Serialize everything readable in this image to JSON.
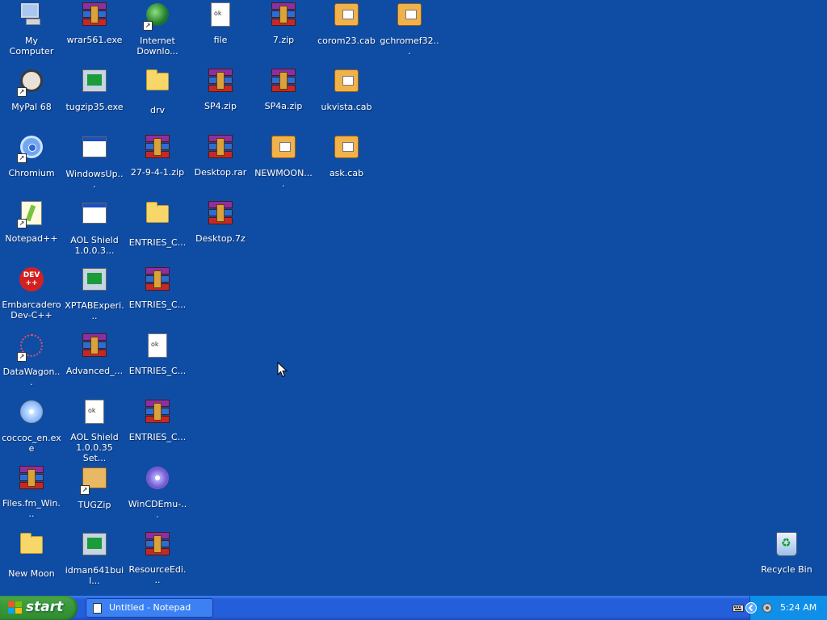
{
  "desktop": {
    "icons": [
      {
        "label": "My Computer"
      },
      {
        "label": "wrar561.exe"
      },
      {
        "label": "Internet Downlo..."
      },
      {
        "label": "file"
      },
      {
        "label": "7.zip"
      },
      {
        "label": "corom23.cab"
      },
      {
        "label": "gchromef32..."
      },
      {
        "label": "MyPal 68"
      },
      {
        "label": "tugzip35.exe"
      },
      {
        "label": "drv"
      },
      {
        "label": "SP4.zip"
      },
      {
        "label": "SP4a.zip"
      },
      {
        "label": "ukvista.cab"
      },
      {
        "label": "Chromium"
      },
      {
        "label": "WindowsUp..."
      },
      {
        "label": "27-9-4-1.zip"
      },
      {
        "label": "Desktop.rar"
      },
      {
        "label": "NEWMOON...."
      },
      {
        "label": "ask.cab"
      },
      {
        "label": "Notepad++"
      },
      {
        "label": "AOL Shield 1.0.0.3..."
      },
      {
        "label": "ENTRIES_C..."
      },
      {
        "label": "Desktop.7z"
      },
      {
        "label": "Embarcadero Dev-C++"
      },
      {
        "label": "XPTABExperi..."
      },
      {
        "label": "ENTRIES_C..."
      },
      {
        "label": "DataWagon..."
      },
      {
        "label": "Advanced_..."
      },
      {
        "label": "ENTRIES_C..."
      },
      {
        "label": "coccoc_en.exe"
      },
      {
        "label": "AOL Shield 1.0.0.35 Set..."
      },
      {
        "label": "ENTRIES_C..."
      },
      {
        "label": "Files.fm_Win..."
      },
      {
        "label": "TUGZip"
      },
      {
        "label": "WinCDEmu-..."
      },
      {
        "label": "New Moon"
      },
      {
        "label": "idman641buil..."
      },
      {
        "label": "ResourceEdi..."
      },
      {
        "label": "Recycle Bin"
      }
    ]
  },
  "taskbar": {
    "start_label": "start",
    "tasks": [
      {
        "label": "Untitled - Notepad"
      }
    ],
    "clock": "5:24 AM"
  },
  "colors": {
    "desktop_bg": "#0f4da5",
    "taskbar": "#245edb",
    "start_button": "#3a9a3a",
    "tray": "#0f8fe8"
  }
}
